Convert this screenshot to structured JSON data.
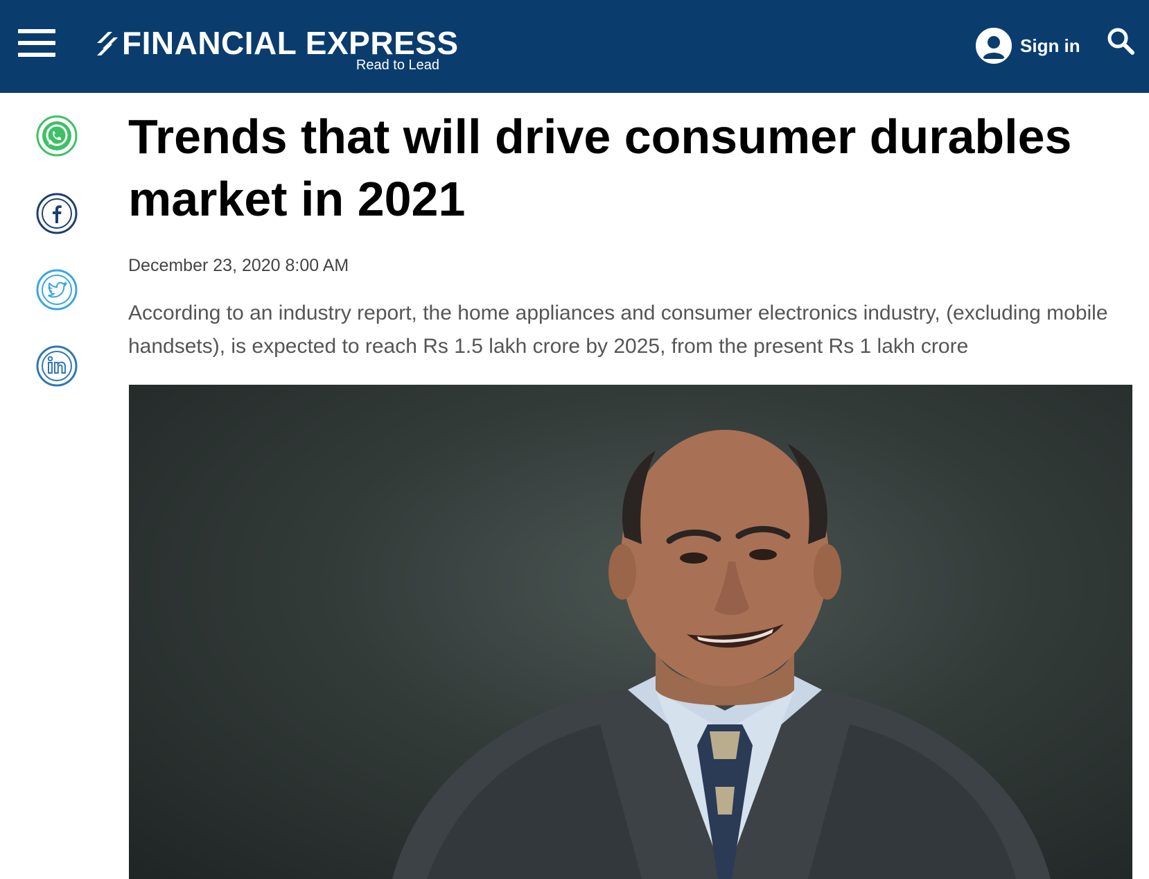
{
  "header": {
    "logo_title": "FINANCIAL EXPRESS",
    "logo_tagline": "Read to Lead",
    "signin_label": "Sign in",
    "background_color": "#0a3d6e"
  },
  "icons": {
    "menu": "hamburger-menu-icon",
    "logo_mark": "logo-mark-icon",
    "avatar": "user-avatar-icon",
    "search": "search-icon",
    "whatsapp": "whatsapp-icon",
    "facebook": "facebook-icon",
    "twitter": "twitter-icon",
    "linkedin": "linkedin-icon"
  },
  "share": {
    "colors": {
      "whatsapp": "#3dc165",
      "facebook": "#1d3f72",
      "twitter": "#3aa6e2",
      "linkedin": "#2f77b5"
    }
  },
  "article": {
    "headline": "Trends that will drive consumer durables market in 2021",
    "dateline": "December 23, 2020 8:00 AM",
    "summary": "According to an industry report, the home appliances and consumer electronics industry, (excluding mobile handsets), is expected to reach Rs 1.5 lakh crore by 2025, from the present Rs 1 lakh crore"
  }
}
